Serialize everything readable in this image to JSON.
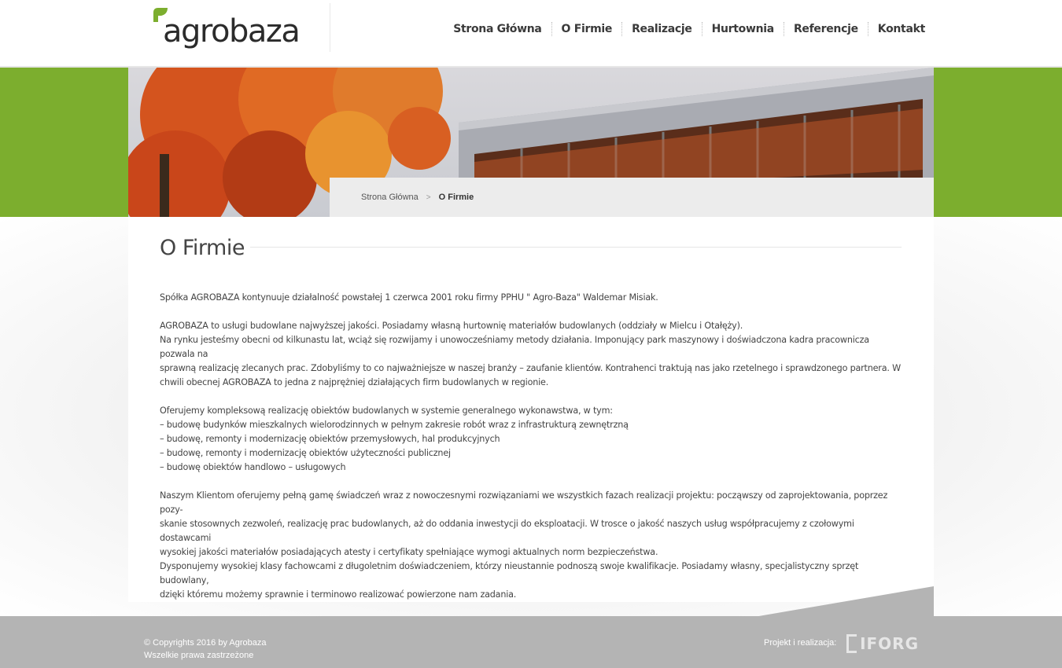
{
  "brand": {
    "name": "agrobaza",
    "accent": "#7cae2e"
  },
  "nav": {
    "items": [
      {
        "label": "Strona Główna"
      },
      {
        "label": "O Firmie"
      },
      {
        "label": "Realizacje"
      },
      {
        "label": "Hurtownia"
      },
      {
        "label": "Referencje"
      },
      {
        "label": "Kontakt"
      }
    ]
  },
  "breadcrumb": {
    "home": "Strona Główna",
    "separator": ">",
    "current": "O Firmie"
  },
  "page": {
    "title": "O Firmie",
    "p1": "Spółka AGROBAZA kontynuuje działalność powstałej 1 czerwca 2001 roku firmy PPHU \" Agro-Baza\" Waldemar Misiak.",
    "p2": [
      "AGROBAZA to usługi budowlane najwyższej jakości. Posiadamy własną hurtownię materiałów budowlanych (oddziały w Mielcu i Otałęży).",
      "Na rynku jesteśmy obecni od kilkunastu lat, wciąż się rozwijamy i unowocześniamy metody działania. Imponujący park maszynowy i doświadczona kadra pracownicza pozwala na",
      "sprawną realizację zlecanych prac. Zdobyliśmy to co najważniejsze w naszej branży – zaufanie klientów. Kontrahenci traktują nas jako rzetelnego i sprawdzonego partnera. W",
      "chwili obecnej AGROBAZA to jedna z najprężniej działających firm budowlanych w regionie."
    ],
    "p3": [
      "Oferujemy kompleksową realizację obiektów budowlanych w systemie generalnego wykonawstwa, w tym:",
      "– budowę budynków mieszkalnych wielorodzinnych w pełnym zakresie robót wraz z infrastrukturą zewnętrzną",
      "– budowę, remonty i modernizację obiektów przemysłowych, hal produkcyjnych",
      "– budowę, remonty i modernizację obiektów użyteczności publicznej",
      "– budowę obiektów handlowo – usługowych"
    ],
    "p4": [
      "Naszym Klientom oferujemy pełną gamę świadczeń wraz z nowoczesnymi rozwiązaniami we wszystkich fazach realizacji projektu: począwszy od zaprojektowania, poprzez pozy-",
      "skanie stosownych zezwoleń, realizację prac budowlanych, aż do oddania inwestycji do eksploatacji. W trosce o jakość naszych usług współpracujemy z czołowymi dostawcami",
      "wysokiej jakości materiałów posiadających atesty i certyfikaty spełniające wymogi aktualnych norm bezpieczeństwa.",
      "Dysponujemy wysokiej klasy fachowcami z długoletnim doświadczeniem, którzy nieustannie podnoszą swoje kwalifikacje. Posiadamy własny, specjalistyczny sprzęt budowlany,",
      "dzięki któremu możemy sprawnie i terminowo realizować powierzone nam zadania."
    ]
  },
  "footer": {
    "copyright": "© Copyrights 2016 by Agrobaza",
    "rights": "Wszelkie prawa zastrzeżone",
    "credit_label": "Projekt i realizacja:",
    "credit_logo": "IFORG",
    "credit_url": "www.iforg.pl",
    "bg": "#b4b4b4"
  }
}
